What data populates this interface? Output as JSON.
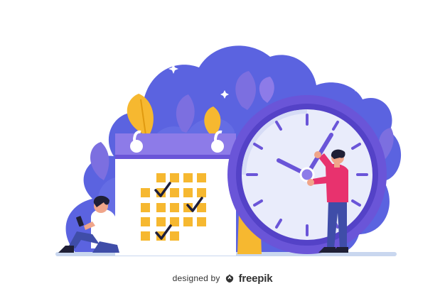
{
  "illustration": {
    "subject": "time-management",
    "elements": [
      "calendar",
      "wall-clock",
      "person-sitting-with-phone",
      "person-adjusting-clock-hands",
      "plant-leaves",
      "sparkles"
    ]
  },
  "credit": {
    "designed_label": "designed by",
    "brand_name": "freepik",
    "brand_icon": "freepik-logo-icon"
  },
  "colors": {
    "background_blob": "#5b63e0",
    "blob_light": "#7b83ec",
    "leaf_purple": "#7c6fe0",
    "leaf_yellow": "#f6b830",
    "calendar_body": "#ffffff",
    "calendar_header": "#8d7be8",
    "calendar_cells": "#f6b830",
    "checkmark": "#1e1e3a",
    "clock_rim": "#6a55d8",
    "clock_face": "#e9ecfb",
    "clock_hands": "#6a55d8",
    "shirt": "#e8326e",
    "pants": "#3f4da8",
    "skin": "#f0a58a",
    "hair": "#1f1f36",
    "floor_line": "#c9d7ef",
    "credit_text": "#333333"
  }
}
